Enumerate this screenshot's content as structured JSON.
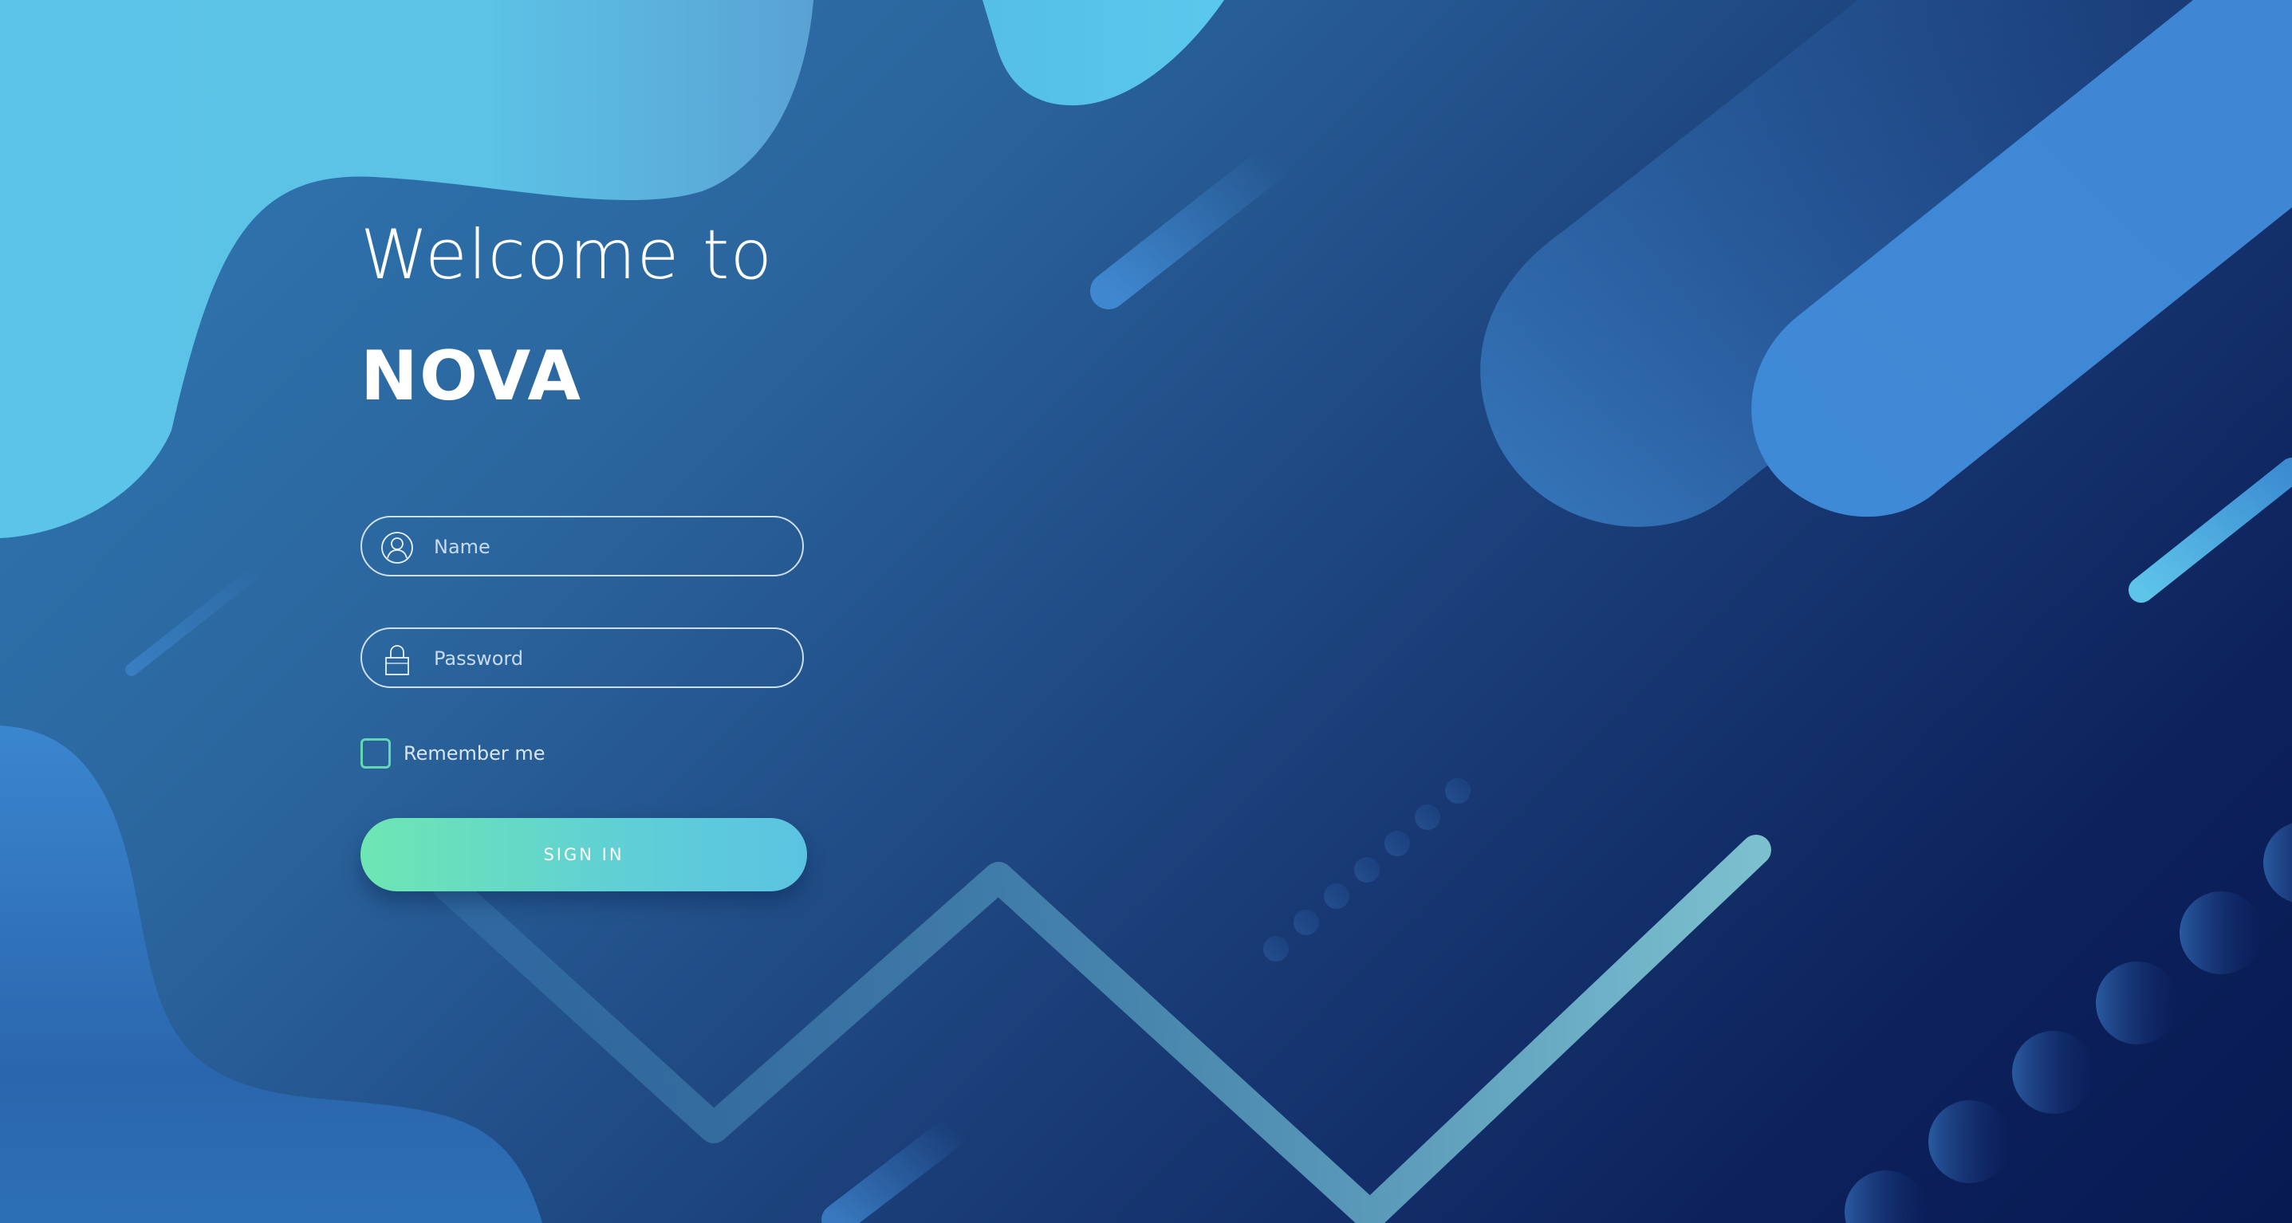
{
  "header": {
    "welcome": "Welcome to",
    "brand": "NOVA"
  },
  "form": {
    "name_placeholder": "Name",
    "password_placeholder": "Password",
    "remember_label": "Remember me",
    "remember_checked": false,
    "signin_label": "SIGN IN"
  },
  "icons": {
    "name": "user-icon",
    "password": "lock-icon"
  },
  "colors": {
    "accent_green": "#6ee6b2",
    "accent_cyan": "#5bc3e2",
    "background_dark": "#081a52",
    "background_mid": "#2b659d"
  }
}
